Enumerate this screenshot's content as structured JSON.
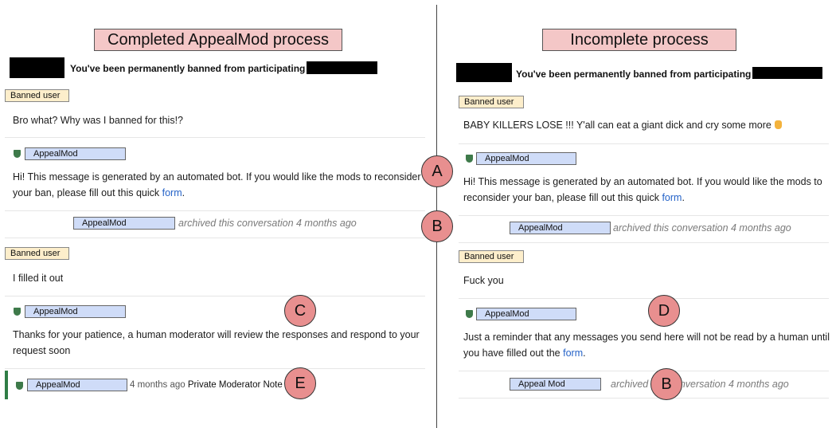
{
  "left": {
    "title": "Completed AppealMod process",
    "ban_header": "You've been permanently banned from participating",
    "banned_tag": "Banned user",
    "mod_tag": "AppealMod",
    "msg1": "Bro what? Why was I banned for this!?",
    "msg2_text": "Hi! This message is generated by an automated bot. If you would like the mods to reconsider your ban, please fill out this quick",
    "msg2_link": "form",
    "archived_user": "AppealMod",
    "archived_text": "archived this conversation 4 months ago",
    "msg3": "I filled it out",
    "msg4": "Thanks for your patience, a human moderator will review the responses and respond to your request soon",
    "note_time": "4 months ago",
    "note_label": "Private Moderator Note"
  },
  "right": {
    "title": "Incomplete process",
    "ban_header": "You've been permanently banned from participating",
    "banned_tag": "Banned user",
    "mod_tag": "AppealMod",
    "msg1": "BABY KILLERS LOSE !!! Y'all can eat a giant dick and cry some more",
    "msg2_text": "Hi! This message is generated by an automated bot. If you would like the mods to reconsider your ban, please fill out this quick",
    "msg2_link": "form",
    "archived_user": "AppealMod",
    "archived_text": "archived this conversation 4 months ago",
    "msg3": "Fuck you",
    "msg4_text": "Just a reminder that any messages you send here will not be read by a human until you have filled out the",
    "msg4_link": "form",
    "archived2_user": "Appeal Mod",
    "archived2_text": "archived this conversation 4 months ago"
  },
  "markers": {
    "a": "A",
    "b": "B",
    "c": "C",
    "d": "D",
    "e": "E"
  },
  "colors": {
    "banned_tag": "#fdeecb",
    "mod_tag": "#cfdcf8",
    "title_box": "#f4c7c7",
    "marker": "#e88f8f",
    "link": "#2563c8",
    "shield": "#3e7a4a"
  }
}
